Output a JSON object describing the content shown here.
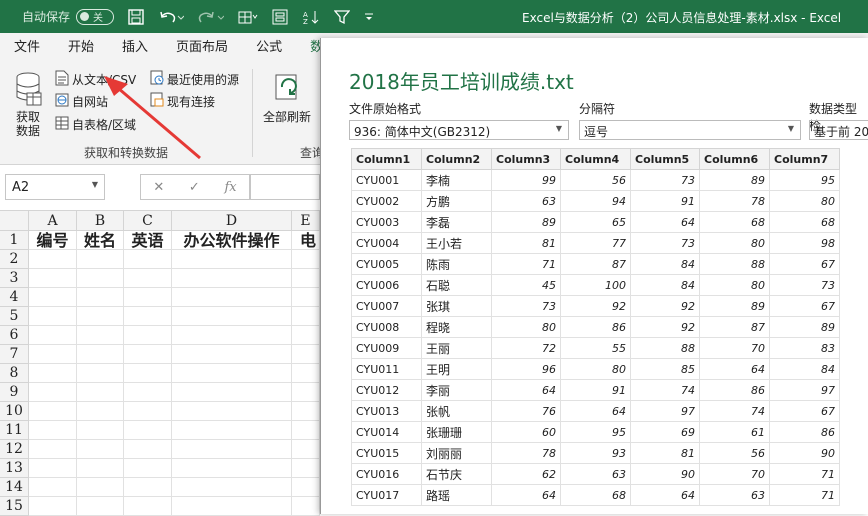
{
  "titlebar": {
    "autosave_label": "自动保存",
    "autosave_state": "关",
    "window_title": "Excel与数据分析（2）公司人员信息处理-素材.xlsx  -  Excel"
  },
  "tabs": [
    "文件",
    "开始",
    "插入",
    "页面布局",
    "公式",
    "数"
  ],
  "ribbon": {
    "get_data": "获取数据",
    "from_text": "从文本/CSV",
    "from_web": "自网站",
    "from_table": "自表格/区域",
    "recent_sources": "最近使用的源",
    "existing_connections": "现有连接",
    "group_label": "获取和转换数据",
    "refresh_all": "全部刷新",
    "query_label": "查询"
  },
  "formula_bar": {
    "name_box": "A2",
    "cancel": "✕",
    "enter": "✓",
    "fx": "fx"
  },
  "sheet": {
    "columns": [
      "A",
      "B",
      "C",
      "D",
      "E"
    ],
    "rows": [
      "1",
      "2",
      "3",
      "4",
      "5",
      "6",
      "7",
      "8",
      "9",
      "10",
      "11",
      "12",
      "13",
      "14",
      "15"
    ],
    "header_row": [
      "编号",
      "姓名",
      "英语",
      "办公软件操作",
      "电"
    ]
  },
  "dialog": {
    "title": "2018年员工培训成绩.txt",
    "file_origin_label": "文件原始格式",
    "file_origin_value": "936: 简体中文(GB2312)",
    "delimiter_label": "分隔符",
    "delimiter_value": "逗号",
    "type_detect_label": "数据类型检",
    "type_detect_value": "基于前 20",
    "columns": [
      "Column1",
      "Column2",
      "Column3",
      "Column4",
      "Column5",
      "Column6",
      "Column7"
    ],
    "rows": [
      [
        "CYU001",
        "李楠",
        "99",
        "56",
        "73",
        "89",
        "95"
      ],
      [
        "CYU002",
        "方鹏",
        "63",
        "94",
        "91",
        "78",
        "80"
      ],
      [
        "CYU003",
        "李磊",
        "89",
        "65",
        "64",
        "68",
        "68"
      ],
      [
        "CYU004",
        "王小若",
        "81",
        "77",
        "73",
        "80",
        "98"
      ],
      [
        "CYU005",
        "陈雨",
        "71",
        "87",
        "84",
        "88",
        "67"
      ],
      [
        "CYU006",
        "石聪",
        "45",
        "100",
        "84",
        "80",
        "73"
      ],
      [
        "CYU007",
        "张琪",
        "73",
        "92",
        "92",
        "89",
        "67"
      ],
      [
        "CYU008",
        "程晓",
        "80",
        "86",
        "92",
        "87",
        "89"
      ],
      [
        "CYU009",
        "王丽",
        "72",
        "55",
        "88",
        "70",
        "83"
      ],
      [
        "CYU011",
        "王明",
        "96",
        "80",
        "85",
        "64",
        "84"
      ],
      [
        "CYU012",
        "李丽",
        "64",
        "91",
        "74",
        "86",
        "97"
      ],
      [
        "CYU013",
        "张帆",
        "76",
        "64",
        "97",
        "74",
        "67"
      ],
      [
        "CYU014",
        "张珊珊",
        "60",
        "95",
        "69",
        "61",
        "86"
      ],
      [
        "CYU015",
        "刘丽丽",
        "78",
        "93",
        "81",
        "56",
        "90"
      ],
      [
        "CYU016",
        "石节庆",
        "62",
        "63",
        "90",
        "70",
        "71"
      ],
      [
        "CYU017",
        "路瑶",
        "64",
        "68",
        "64",
        "63",
        "71"
      ]
    ]
  },
  "colors": {
    "excel_green": "#217346",
    "annotation_red": "#e53935"
  }
}
